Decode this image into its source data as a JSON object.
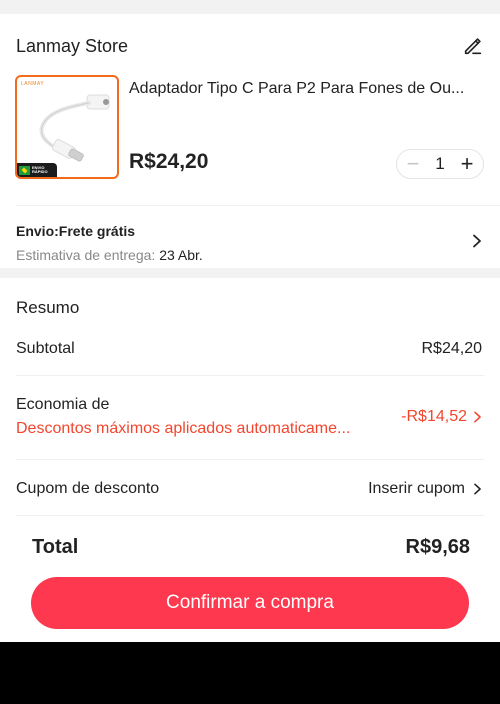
{
  "store": {
    "name": "Lanmay Store"
  },
  "product": {
    "title": "Adaptador Tipo C Para P2 Para Fones de Ou...",
    "price": "R$24,20",
    "quantity": "1",
    "thumb_logo": "LANMAY",
    "thumb_badge": "ENVIO RÁPIDO"
  },
  "shipping": {
    "title": "Envio:Frete grátis",
    "estimate_label": "Estimativa de entrega: ",
    "estimate_date": "23 Abr."
  },
  "summary": {
    "title": "Resumo",
    "subtotal_label": "Subtotal",
    "subtotal_value": "R$24,20",
    "economia_label": "Economia de",
    "economia_sub": "Descontos máximos aplicados automaticame...",
    "economia_value": "-R$14,52",
    "cupom_label": "Cupom de desconto",
    "cupom_value": "Inserir cupom",
    "total_label": "Total",
    "total_value": "R$9,68"
  },
  "actions": {
    "confirm_label": "Confirmar a compra"
  },
  "icons": {
    "edit": "pencil-icon",
    "minus": "minus-icon",
    "plus": "plus-icon",
    "chevron": "chevron-right-icon"
  },
  "colors": {
    "accent": "#fd384f",
    "discount": "#f2462e",
    "thumb_border": "#f26a1b"
  }
}
